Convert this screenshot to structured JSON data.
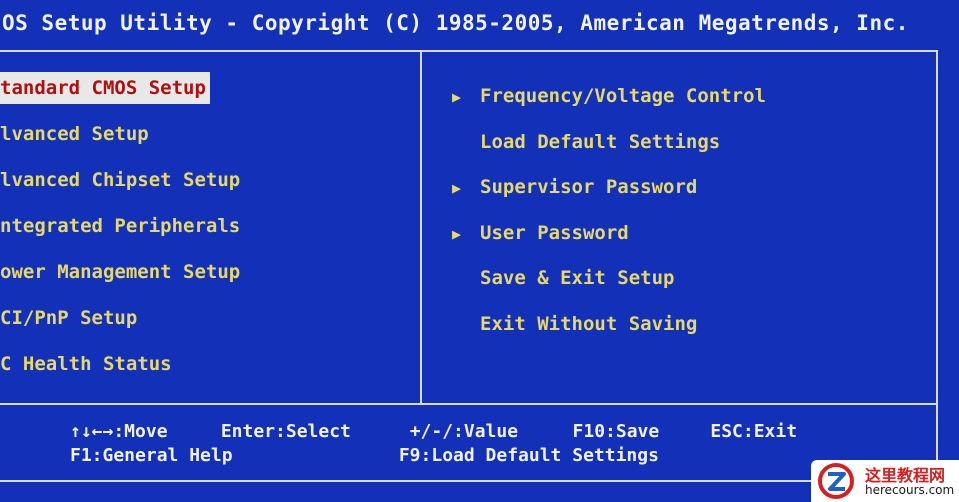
{
  "title": "OS Setup Utility - Copyright (C) 1985-2005, American Megatrends, Inc.",
  "left_menu": [
    {
      "label": "tandard CMOS Setup",
      "selected": true
    },
    {
      "label": "lvanced Setup",
      "selected": false
    },
    {
      "label": "lvanced Chipset Setup",
      "selected": false
    },
    {
      "label": "ntegrated Peripherals",
      "selected": false
    },
    {
      "label": "ower Management Setup",
      "selected": false
    },
    {
      "label": "CI/PnP Setup",
      "selected": false
    },
    {
      "label": "C Health Status",
      "selected": false
    }
  ],
  "right_menu": [
    {
      "label": "Frequency/Voltage Control",
      "submenu": true
    },
    {
      "label": "Load Default Settings",
      "submenu": false
    },
    {
      "label": "Supervisor Password",
      "submenu": true
    },
    {
      "label": "User Password",
      "submenu": true
    },
    {
      "label": "Save & Exit Setup",
      "submenu": false
    },
    {
      "label": "Exit Without Saving",
      "submenu": false
    }
  ],
  "arrow_glyph": "▶",
  "footer": {
    "row1": {
      "move": "↑↓←→:Move",
      "select": "Enter:Select",
      "value": "+/-/:Value",
      "save": "F10:Save",
      "exit": "ESC:Exit"
    },
    "row2": {
      "help": "F1:General Help",
      "defaults": "F9:Load Default Settings"
    }
  },
  "watermark": {
    "title": "这里教程网",
    "url": "herecours.com"
  },
  "colors": {
    "background": "#1230b8",
    "menu_text": "#e6d86a",
    "selected_bg": "#e8e8e8",
    "selected_text": "#b01010",
    "title_text": "#f2f2f2"
  }
}
